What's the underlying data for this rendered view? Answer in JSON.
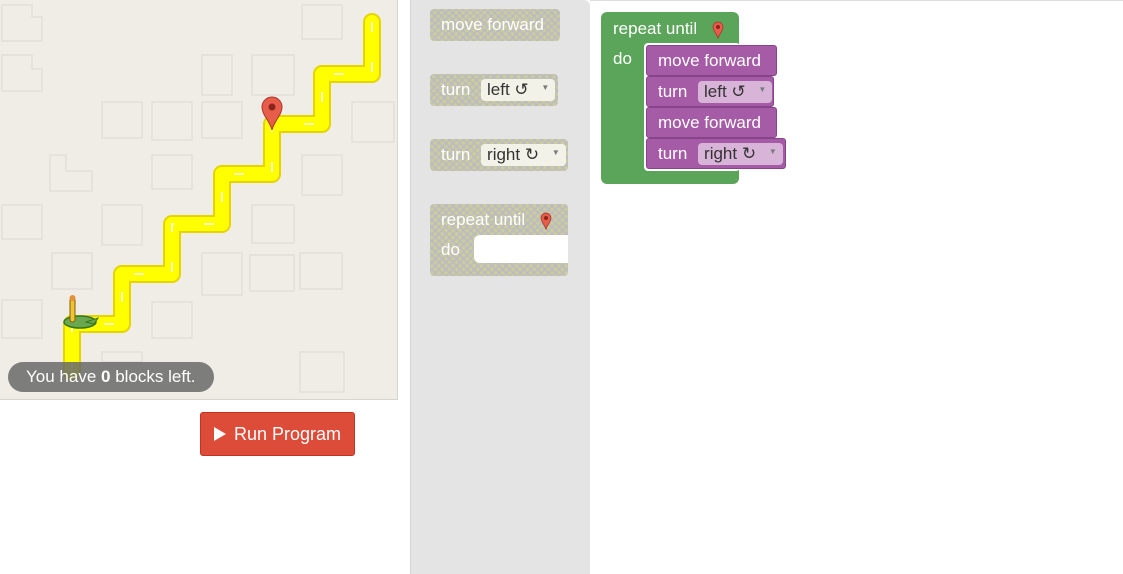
{
  "maze": {
    "blocks_left_prefix": "You have",
    "blocks_left_count": "0",
    "blocks_left_suffix": "blocks left."
  },
  "run_button": {
    "label": "Run Program"
  },
  "toolbox": {
    "move_forward": "move forward",
    "turn_left": {
      "label": "turn",
      "option": "left ↺"
    },
    "turn_right": {
      "label": "turn",
      "option": "right ↻"
    },
    "repeat_until": {
      "label": "repeat until",
      "do": "do"
    }
  },
  "workspace": {
    "repeat_until": "repeat until",
    "do": "do",
    "blocks": [
      {
        "text": "move forward"
      },
      {
        "text": "turn",
        "option": "left ↺"
      },
      {
        "text": "move forward"
      },
      {
        "text": "turn",
        "option": "right ↻"
      }
    ]
  },
  "colors": {
    "path": "#ffff00",
    "loop_block": "#5ba55b",
    "action_block": "#a55ba5",
    "run_button": "#dd4b39",
    "goal_marker": "#e85c4a"
  }
}
